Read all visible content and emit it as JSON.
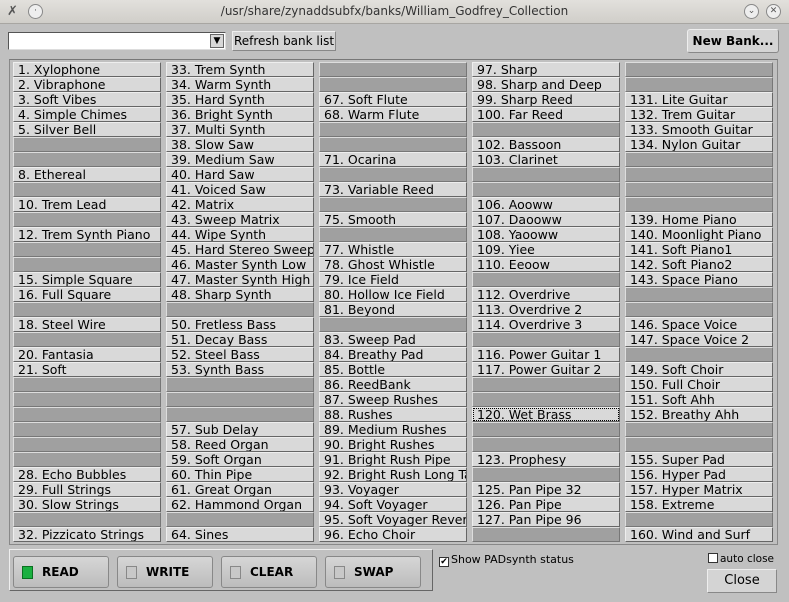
{
  "window": {
    "title": "/usr/share/zynaddsubfx/banks/William_Godfrey_Collection",
    "menu_icon": "x-logo-icon",
    "minimize_icon": "chevron-down-icon",
    "close_icon": "close-icon"
  },
  "toolbar": {
    "bank_combo_value": "",
    "refresh_label": "Refresh bank list",
    "new_bank_label": "New Bank..."
  },
  "selected_slot": 120,
  "slots": [
    "Xylophone",
    "Vibraphone",
    "Soft Vibes",
    "Simple Chimes",
    "Silver Bell",
    "",
    "",
    "Ethereal",
    "",
    "Trem Lead",
    "",
    "Trem Synth Piano",
    "",
    "",
    "Simple Square",
    "Full Square",
    "",
    "Steel Wire",
    "",
    "Fantasia",
    "Soft",
    "",
    "",
    "",
    "",
    "",
    "",
    "Echo Bubbles",
    "Full Strings",
    "Slow Strings",
    "",
    "Pizzicato Strings",
    "Trem Synth",
    "Warm Synth",
    "Hard Synth",
    "Bright Synth",
    "Multi Synth",
    "Slow Saw",
    "Medium Saw",
    "Hard Saw",
    "Voiced Saw",
    "Matrix",
    "Sweep Matrix",
    "Wipe Synth",
    "Hard Stereo Sweep",
    "Master Synth Low",
    "Master Synth High",
    "Sharp Synth",
    "",
    "Fretless Bass",
    "Decay Bass",
    "Steel Bass",
    "Synth Bass",
    "",
    "",
    "",
    "Sub Delay",
    "Reed Organ",
    "Soft Organ",
    "Thin Pipe",
    "Great Organ",
    "Hammond Organ",
    "",
    "Sines",
    "",
    "",
    "Soft Flute",
    "Warm Flute",
    "",
    "",
    "Ocarina",
    "",
    "Variable Reed",
    "",
    "Smooth",
    "",
    "Whistle",
    "Ghost Whistle",
    "Ice Field",
    "Hollow Ice Field",
    "Beyond",
    "",
    "Sweep Pad",
    "Breathy Pad",
    "Bottle",
    "ReedBank",
    "Sweep Rushes",
    "Rushes",
    "Medium Rushes",
    "Bright Rushes",
    "Bright Rush Pipe",
    "Bright Rush Long Tail",
    "Voyager",
    "Soft Voyager",
    "Soft Voyager Reverb",
    "Echo Choir",
    "Sharp",
    "Sharp and Deep",
    "Sharp Reed",
    "Far Reed",
    "",
    "Bassoon",
    "Clarinet",
    "",
    "",
    "Aooww",
    "Daooww",
    "Yaooww",
    "Yiee",
    "Eeoow",
    "",
    "Overdrive",
    "Overdrive 2",
    "Overdrive 3",
    "",
    "Power Guitar 1",
    "Power Guitar 2",
    "",
    "",
    "Wet Brass",
    "",
    "",
    "Prophesy",
    "",
    "Pan Pipe 32",
    "Pan Pipe",
    "Pan Pipe 96",
    "",
    "",
    "",
    "Lite Guitar",
    "Trem Guitar",
    "Smooth Guitar",
    "Nylon Guitar",
    "",
    "",
    "",
    "",
    "Home Piano",
    "Moonlight Piano",
    "Soft Piano1",
    "Soft Piano2",
    "Space Piano",
    "",
    "",
    "Space Voice",
    "Space Voice 2",
    "",
    "Soft Choir",
    "Full Choir",
    "Soft Ahh",
    "Breathy Ahh",
    "",
    "",
    "Super Pad",
    "Hyper Pad",
    "Hyper Matrix",
    "Extreme",
    "",
    "Wind and Surf"
  ],
  "modes": [
    {
      "label": "READ",
      "active": true
    },
    {
      "label": "WRITE",
      "active": false
    },
    {
      "label": "CLEAR",
      "active": false
    },
    {
      "label": "SWAP",
      "active": false
    }
  ],
  "show_padsynth": {
    "label": "Show PADsynth status",
    "checked": true
  },
  "auto_close": {
    "label": "auto close",
    "checked": false
  },
  "close_label": "Close",
  "colors": {
    "led_on": "#1ab040",
    "empty_slot": "#a0a0a0",
    "filled_slot": "#d9d9d9"
  }
}
